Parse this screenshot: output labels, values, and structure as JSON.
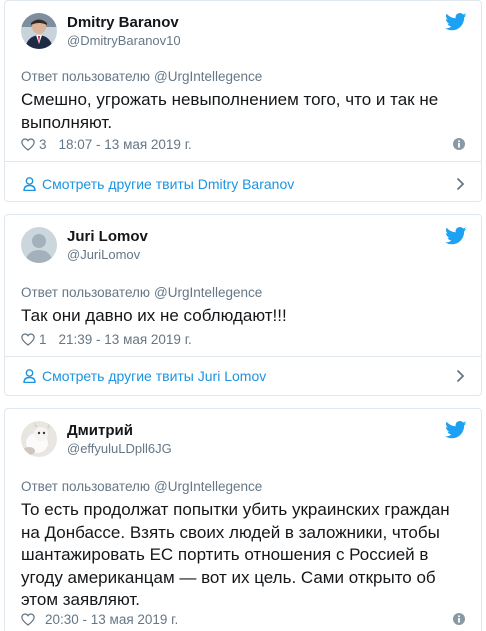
{
  "tweets": [
    {
      "name": "Dmitry Baranov",
      "handle": "@DmitryBaranov10",
      "reply_prefix": "Ответ пользователю",
      "reply_to": "@UrgIntellegence",
      "text": "Смешно, угрожать невыполнением того, что и так не выполняют.",
      "likes": "3",
      "time": "18:07 - 13 мая 2019 г.",
      "more_label": "Смотреть другие твиты Dmitry Baranov"
    },
    {
      "name": "Juri Lomov",
      "handle": "@JuriLomov",
      "reply_prefix": "Ответ пользователю",
      "reply_to": "@UrgIntellegence",
      "text": "Так они давно их не соблюдают!!!",
      "likes": "1",
      "time": "21:39 - 13 мая 2019 г.",
      "more_label": "Смотреть другие твиты Juri Lomov"
    },
    {
      "name": "Дмитрий",
      "handle": "@effyuluLDpll6JG",
      "reply_prefix": "Ответ пользователю",
      "reply_to": "@UrgIntellegence",
      "text": "То есть продолжат попытки убить украинских граждан на Донбассе. Взять своих людей в заложники, чтобы шантажировать ЕС портить отношения с Россией в угоду американцам — вот их цель. Сами открыто об этом заявляют.",
      "likes": "",
      "time": "20:30 - 13 мая 2019 г."
    }
  ],
  "colors": {
    "accent": "#1da1f2",
    "link": "#1b95e0",
    "muted": "#657786",
    "border": "#e1e8ed"
  },
  "icons": {
    "brand": "twitter-bird-icon",
    "like": "heart-icon",
    "info": "info-icon",
    "profile": "user-icon",
    "chevron": "chevron-right-icon"
  }
}
